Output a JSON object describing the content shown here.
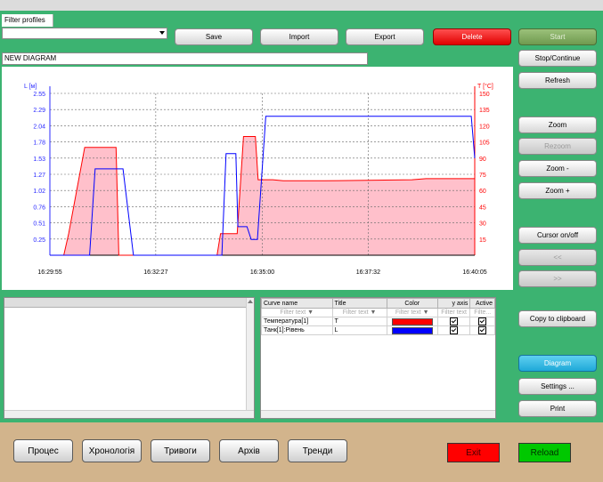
{
  "filter_profiles": {
    "label": "Filter profiles",
    "value": ""
  },
  "toolbar": {
    "save": "Save",
    "import": "Import",
    "export": "Export",
    "delete": "Delete"
  },
  "diagram_title": "NEW DIAGRAM",
  "right_panel": {
    "start": "Start",
    "stop_continue": "Stop/Continue",
    "refresh": "Refresh",
    "zoom": "Zoom",
    "rezoom": "Rezoom",
    "zoom_minus": "Zoom -",
    "zoom_plus": "Zoom +",
    "cursor": "Cursor on/off",
    "prev": "<<",
    "next": ">>",
    "copy": "Copy to clipboard",
    "diagram": "Diagram",
    "settings": "Settings ...",
    "print": "Print"
  },
  "curve_table": {
    "headers": [
      "Curve name",
      "Title",
      "Color",
      "y axis",
      "Active"
    ],
    "filter_placeholders": [
      "Filter text",
      "Filter text",
      "Filter text",
      "Filter text",
      "Filte..."
    ],
    "rows": [
      {
        "name": "Температура[1]",
        "title": "T",
        "color": "#ff0000",
        "y_axis": true,
        "active": true
      },
      {
        "name": "Танк[1]:Рівень",
        "title": "L",
        "color": "#0000ff",
        "y_axis": true,
        "active": true
      }
    ]
  },
  "nav": {
    "process": "Процес",
    "chronology": "Хронологія",
    "alarms": "Тривоги",
    "archive": "Архів",
    "trends": "Тренди"
  },
  "exit": "Exit",
  "reload": "Reload",
  "colors": {
    "background": "#3cb371",
    "level": "#0000ff",
    "temperature": "#ff0000",
    "temp_fill": "#ffc0cb",
    "delete": "#ff0000",
    "reload": "#00c800",
    "diagram_active": "#1fa8d8"
  },
  "chart_data": {
    "type": "line",
    "xlabel": "",
    "x_ticks": [
      "16:29:55",
      "16:32:27",
      "16:35:00",
      "16:37:32",
      "16:40:05"
    ],
    "left_axis": {
      "label": "L [м]",
      "ticks": [
        "0.25",
        "0.51",
        "0.76",
        "1.02",
        "1.27",
        "1.53",
        "1.78",
        "2.04",
        "2.29",
        "2.55"
      ],
      "range": [
        0,
        2.55
      ],
      "color": "#2a2aff"
    },
    "right_axis": {
      "label": "T [°C]",
      "ticks": [
        "15",
        "30",
        "45",
        "60",
        "75",
        "90",
        "105",
        "120",
        "135",
        "150"
      ],
      "range": [
        0,
        150
      ],
      "color": "#ff0000"
    },
    "grid": true,
    "series": [
      {
        "name": "Танк[1]:Рівень",
        "axis": "left",
        "color": "#0000ff",
        "x": [
          "16:29:55",
          "16:30:52",
          "16:31:00",
          "16:31:40",
          "16:31:55",
          "16:31:58",
          "16:34:02",
          "16:34:08",
          "16:34:22",
          "16:34:25",
          "16:34:38",
          "16:34:44",
          "16:34:53",
          "16:35:05",
          "16:35:20",
          "16:35:30",
          "16:40:00",
          "16:40:05"
        ],
        "y": [
          0.0,
          0.0,
          1.36,
          1.36,
          0.0,
          0.0,
          0.0,
          1.6,
          1.6,
          0.45,
          0.45,
          0.25,
          0.25,
          2.19,
          2.19,
          2.19,
          2.19,
          1.53
        ]
      },
      {
        "name": "Температура[1]",
        "axis": "right",
        "color": "#ff0000",
        "fill": "#ffc0cb",
        "x": [
          "16:29:55",
          "16:30:15",
          "16:30:22",
          "16:30:45",
          "16:31:00",
          "16:31:30",
          "16:31:34",
          "16:33:55",
          "16:34:00",
          "16:34:24",
          "16:34:33",
          "16:34:50",
          "16:34:54",
          "16:35:15",
          "16:35:30",
          "16:36:30",
          "16:38:35",
          "16:38:55",
          "16:40:05"
        ],
        "y": [
          0,
          0,
          20,
          100,
          100,
          100,
          0,
          0,
          20,
          20,
          110,
          110,
          70,
          70,
          69,
          69,
          70,
          71,
          71
        ]
      }
    ]
  }
}
